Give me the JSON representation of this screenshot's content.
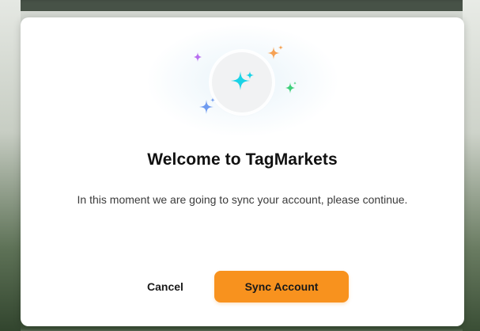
{
  "app": {
    "brand_color": "#f8921e"
  },
  "modal": {
    "hero_icon": "sparkles-icon",
    "sparkle_colors": {
      "center": "#19d3e6",
      "orange": "#f6a254",
      "purple": "#b86ff0",
      "green": "#3ecf7a",
      "blue": "#6f9bf0"
    },
    "title": "Welcome to TagMarkets",
    "message": "In this moment we are going to sync your account, please continue.",
    "cancel_label": "Cancel",
    "sync_label": "Sync Account"
  }
}
